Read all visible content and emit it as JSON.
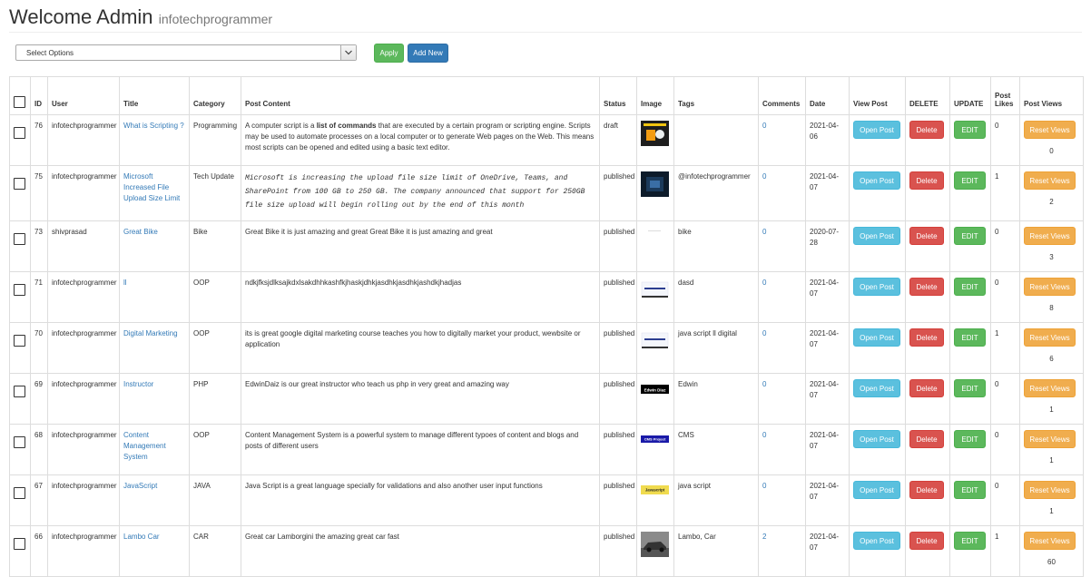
{
  "header": {
    "title": "Welcome Admin",
    "subtitle": "infotechprogrammer"
  },
  "toolbar": {
    "select_value": "Select Options",
    "apply_label": "Apply",
    "add_new_label": "Add New"
  },
  "columns": [
    "ID",
    "User",
    "Title",
    "Category",
    "Post Content",
    "Status",
    "Image",
    "Tags",
    "Comments",
    "Date",
    "View Post",
    "DELETE",
    "UPDATE",
    "Post Likes",
    "Post Views"
  ],
  "rows": [
    {
      "id": "76",
      "user": "infotechprogrammer",
      "title": "What is Scripting ?",
      "category": "Programming",
      "content_parts": [
        "A computer script is a ",
        "list of commands",
        " that are executed by a certain program or scripting engine. Scripts may be used to automate processes on a local computer or to generate Web pages on the Web. This means most scripts can be opened and edited using a basic text editor."
      ],
      "status": "draft",
      "image": "dark-scripting-thumbnail",
      "tags": "",
      "comments": "0",
      "date": "2021-04-06",
      "open": "Open Post",
      "delete": "Delete",
      "edit": "EDIT",
      "likes": "0",
      "reset": "Reset Views",
      "views": "0"
    },
    {
      "id": "75",
      "user": "infotechprogrammer",
      "title": "Microsoft Increased File Upload Size Limit",
      "category": "Tech Update",
      "content": "Microsoft is increasing the upload file size limit of OneDrive, Teams, and SharePoint from 100 GB to 250 GB. The company announced that support for 250GB file size upload will begin rolling out by the end of this month",
      "status": "published",
      "image": "dark-tech-thumbnail",
      "tags": "@infotechprogrammer",
      "comments": "0",
      "date": "2021-04-07",
      "open": "Open Post",
      "delete": "Delete",
      "edit": "EDIT",
      "likes": "1",
      "reset": "Reset Views",
      "views": "2"
    },
    {
      "id": "73",
      "user": "shivprasad",
      "title": "Great Bike",
      "category": "Bike",
      "content": "Great Bike it is just amazing and great Great Bike it is just amazing and great",
      "status": "published",
      "image": "blank-thumbnail",
      "tags": "bike",
      "comments": "0",
      "date": "2020-07-28",
      "open": "Open Post",
      "delete": "Delete",
      "edit": "EDIT",
      "likes": "0",
      "reset": "Reset Views",
      "views": "3"
    },
    {
      "id": "71",
      "user": "infotechprogrammer",
      "title": "ll",
      "category": "OOP",
      "content": "ndkjfksjdlksajkdxlsakdhhkashfkjhaskjdhkjasdhkjasdhkjashdkjhadjas",
      "status": "published",
      "image": "blue-bar-thumbnail",
      "tags": "dasd",
      "comments": "0",
      "date": "2021-04-07",
      "open": "Open Post",
      "delete": "Delete",
      "edit": "EDIT",
      "likes": "0",
      "reset": "Reset Views",
      "views": "8"
    },
    {
      "id": "70",
      "user": "infotechprogrammer",
      "title": "Digital Marketing",
      "category": "OOP",
      "content": "its is great google digital marketing course teaches you how to digitally market your product, wewbsite or application",
      "status": "published",
      "image": "blue-bar-thumbnail",
      "tags": "java script ll digital",
      "comments": "0",
      "date": "2021-04-07",
      "open": "Open Post",
      "delete": "Delete",
      "edit": "EDIT",
      "likes": "1",
      "reset": "Reset Views",
      "views": "6"
    },
    {
      "id": "69",
      "user": "infotechprogrammer",
      "title": "Instructor",
      "category": "PHP",
      "content": "EdwinDaiz is our great instructor who teach us php in very great and amazing way",
      "status": "published",
      "image": "edwin-diaz-thumbnail",
      "image_text": "Edwin Diaz",
      "tags": "Edwin",
      "comments": "0",
      "date": "2021-04-07",
      "open": "Open Post",
      "delete": "Delete",
      "edit": "EDIT",
      "likes": "0",
      "reset": "Reset Views",
      "views": "1"
    },
    {
      "id": "68",
      "user": "infotechprogrammer",
      "title": "Content Management System",
      "category": "OOP",
      "content": "Content Management System is a powerful system to manage different typoes of content and blogs and posts of different users",
      "status": "published",
      "image": "cms-project-thumbnail",
      "image_text": "CMS Project",
      "tags": "CMS",
      "comments": "0",
      "date": "2021-04-07",
      "open": "Open Post",
      "delete": "Delete",
      "edit": "EDIT",
      "likes": "0",
      "reset": "Reset Views",
      "views": "1"
    },
    {
      "id": "67",
      "user": "infotechprogrammer",
      "title": "JavaScript",
      "category": "JAVA",
      "content": "Java Script is a great language specially for validations and also another user input functions",
      "status": "published",
      "image": "javascript-thumbnail",
      "image_text": "Javascript",
      "tags": "java script",
      "comments": "0",
      "date": "2021-04-07",
      "open": "Open Post",
      "delete": "Delete",
      "edit": "EDIT",
      "likes": "0",
      "reset": "Reset Views",
      "views": "1"
    },
    {
      "id": "66",
      "user": "infotechprogrammer",
      "title": "Lambo Car",
      "category": "CAR",
      "content": "Great car Lamborgini the amazing great car fast",
      "status": "published",
      "image": "car-photo-thumbnail",
      "tags": "Lambo, Car",
      "comments": "2",
      "date": "2021-04-07",
      "open": "Open Post",
      "delete": "Delete",
      "edit": "EDIT",
      "likes": "1",
      "reset": "Reset Views",
      "views": "60"
    }
  ]
}
